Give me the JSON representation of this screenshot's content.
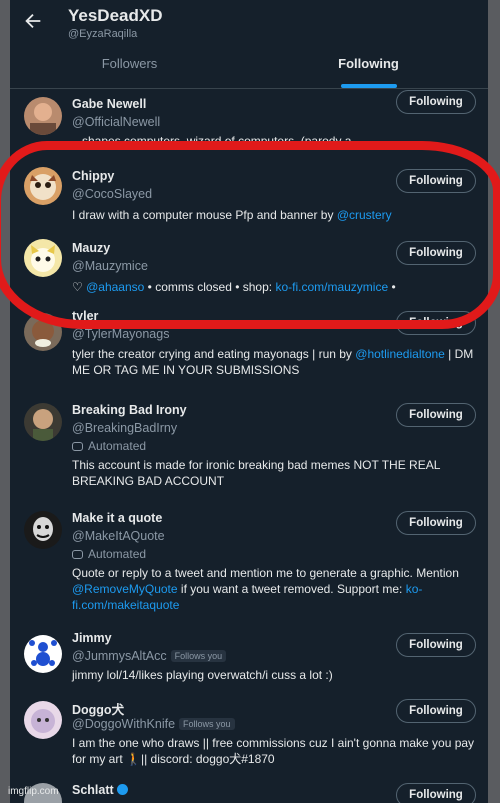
{
  "header": {
    "title": "YesDeadXD",
    "handle": "@EyzaRaqilla"
  },
  "tabs": [
    {
      "label": "Followers",
      "active": false
    },
    {
      "label": "Following",
      "active": true
    }
  ],
  "button_label": "Following",
  "automated_label": "Automated",
  "follows_you_label": "Follows you",
  "accounts": [
    {
      "name": "Gabe Newell",
      "handle": "@OfficialNewell",
      "bio": "...shapes computers, wizard of computers. (parody a..."
    },
    {
      "name": "Chippy",
      "handle": "@CocoSlayed",
      "bio_text": "I draw with a computer mouse Pfp and banner by ",
      "bio_link": "@crustery"
    },
    {
      "name": "Mauzy",
      "handle": "@Mauzymice",
      "bio_prefix": "♡ ",
      "bio_link1": "@ahaanso",
      "bio_mid": " • comms closed • shop: ",
      "bio_link2": "ko-fi.com/mauzymice",
      "bio_suffix": " •"
    },
    {
      "name": "tyler the creator",
      "handle": "@TylerMayonags",
      "bio_text": "tyler the creator crying and eating mayonags | run by ",
      "bio_link": "@hotlinedialtone",
      "bio_text2": " | DM ME OR TAG ME IN YOUR SUBMISSIONS"
    },
    {
      "name": "Breaking Bad Irony",
      "handle": "@BreakingBadIrny",
      "bio": "This account is made for ironic breaking bad memes NOT THE REAL BREAKING BAD ACCOUNT"
    },
    {
      "name": "Make it a quote",
      "handle": "@MakeItAQuote",
      "bio_text": "Quote or reply to a tweet and mention me to generate a graphic. Mention ",
      "bio_link": "@RemoveMyQuote",
      "bio_text2": " if you want a tweet removed. Support me: ",
      "bio_link2": "ko-fi.com/makeitaquote"
    },
    {
      "name": "Jimmy",
      "handle": "@JummysAltAcc",
      "bio": "jimmy lol/14/likes playing overwatch/i cuss a lot :)"
    },
    {
      "name": "Doggo犬",
      "handle": "@DoggoWithKnife",
      "bio": "I am the one who draws || free commissions cuz I ain't gonna make you pay for my art 🚶|| discord: doggo犬#1870"
    },
    {
      "name": "Schlatt",
      "handle": ""
    }
  ],
  "watermark": "imgflip.com",
  "colors": {
    "bg": "#15202b",
    "accent": "#1d9bf0",
    "annotation": "#e11a1a"
  }
}
